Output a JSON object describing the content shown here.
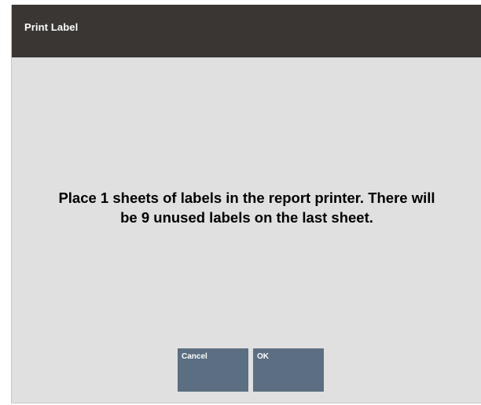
{
  "dialog": {
    "title": "Print Label",
    "message_line1": "Place 1 sheets of labels in the report printer.  There will",
    "message_line2": "be 9 unused labels on the last sheet."
  },
  "buttons": {
    "cancel_label": "Cancel",
    "ok_label": "OK"
  },
  "colors": {
    "title_bar": "#3a3633",
    "body_background": "#e0e0e0",
    "button": "#5b6e82"
  }
}
